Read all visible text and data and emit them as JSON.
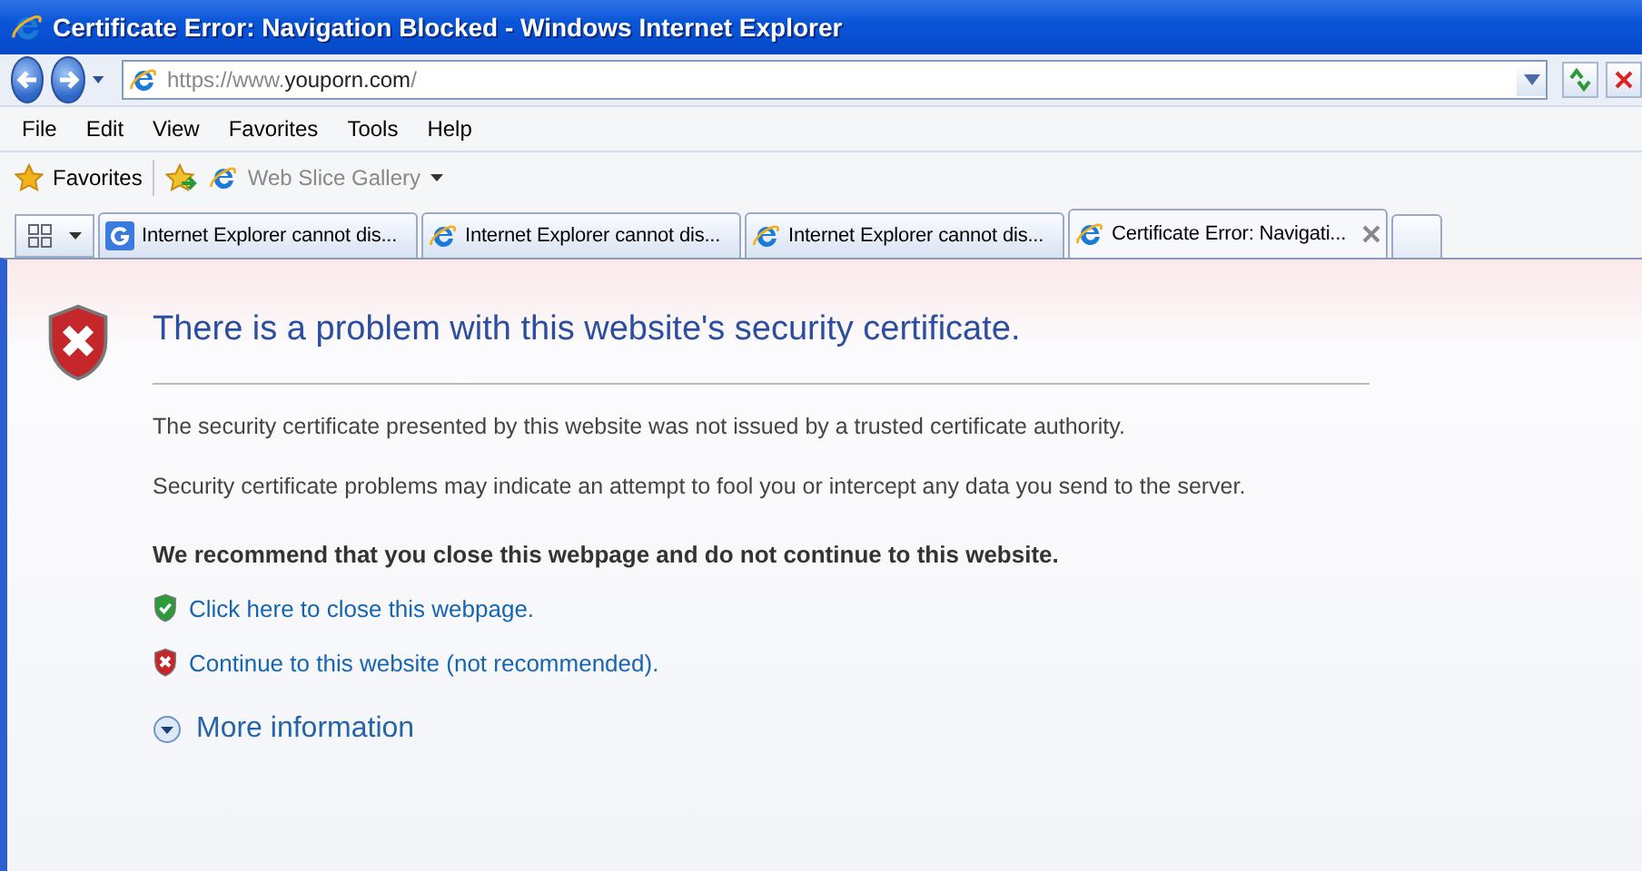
{
  "window": {
    "title": "Certificate Error: Navigation Blocked - Windows Internet Explorer"
  },
  "address_bar": {
    "value_prefix": "https://www.",
    "value_domain": "youporn.com",
    "value_suffix": "/"
  },
  "menu": [
    "File",
    "Edit",
    "View",
    "Favorites",
    "Tools",
    "Help"
  ],
  "favorites_bar": {
    "favorites": "Favorites",
    "web_slice": "Web Slice Gallery"
  },
  "tabs": [
    {
      "label": "Internet Explorer cannot dis...",
      "kind": "google",
      "selected": false
    },
    {
      "label": "Internet Explorer cannot dis...",
      "kind": "ie",
      "selected": false
    },
    {
      "label": "Internet Explorer cannot dis...",
      "kind": "ie",
      "selected": false
    },
    {
      "label": "Certificate Error: Navigati...",
      "kind": "ie",
      "selected": true
    }
  ],
  "page": {
    "heading": "There is a problem with this website's security certificate.",
    "paragraphs": [
      "The security certificate presented by this website was not issued by a trusted certificate authority.",
      "Security certificate problems may indicate an attempt to fool you or intercept any data you send to the server."
    ],
    "recommendation": "We recommend that you close this webpage and do not continue to this website.",
    "links": [
      {
        "label": "Click here to close this webpage.",
        "kind": "safe"
      },
      {
        "label": "Continue to this website (not recommended).",
        "kind": "unsafe"
      }
    ],
    "more_info": {
      "label": "More information",
      "expanded": false
    }
  }
}
